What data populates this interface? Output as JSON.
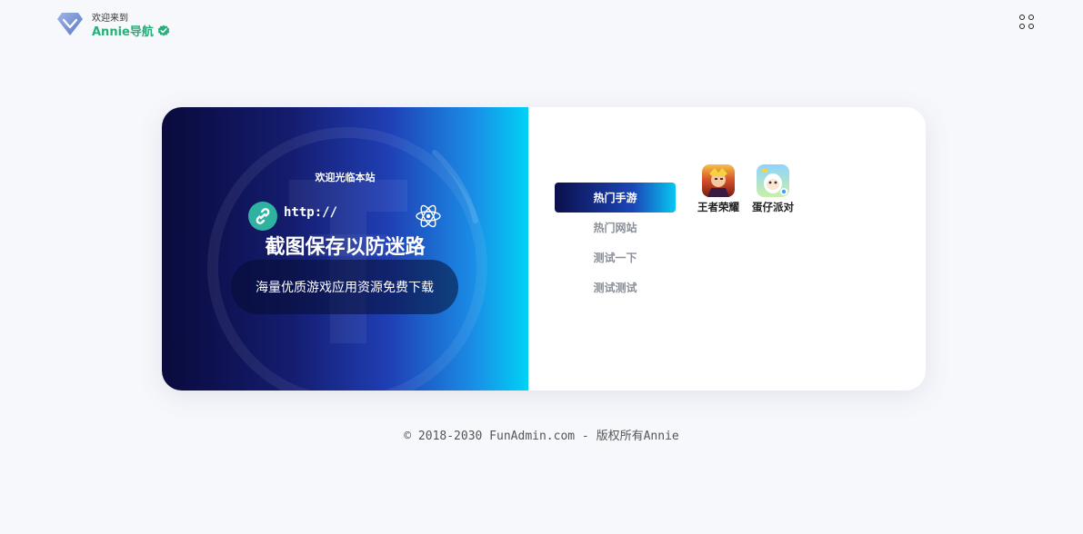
{
  "header": {
    "welcome": "欢迎来到",
    "brand": "Annie导航",
    "brand_color": "#27b07a"
  },
  "banner": {
    "welcome": "欢迎光临本站",
    "http_text": "http://",
    "title": "截图保存以防迷路",
    "subtitle": "海量优质游戏应用资源免费下载"
  },
  "tabs": [
    {
      "label": "热门手游",
      "active": true
    },
    {
      "label": "热门网站",
      "active": false
    },
    {
      "label": "测试一下",
      "active": false
    },
    {
      "label": "测试测试",
      "active": false
    }
  ],
  "apps": [
    {
      "name": "王者荣耀",
      "icon": "game-king-icon"
    },
    {
      "name": "蛋仔派对",
      "icon": "game-eggy-icon"
    }
  ],
  "footer": {
    "copyright": "© 2018-2030 FunAdmin.com - 版权所有Annie"
  },
  "colors": {
    "accent_dark": "#0b0f4d",
    "accent_light": "#07c7f2",
    "page_bg": "#f7f8fb"
  }
}
